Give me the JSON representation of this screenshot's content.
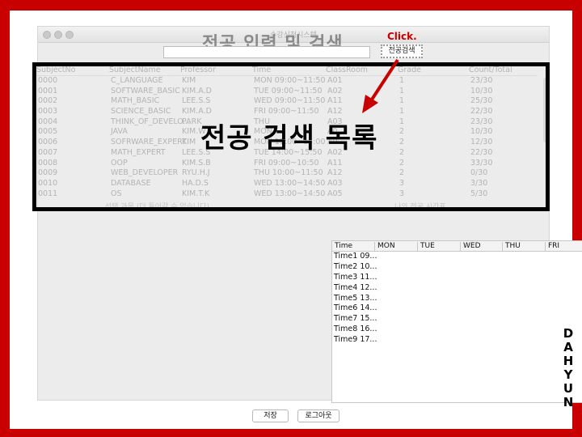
{
  "window": {
    "title": "수강신청시스템"
  },
  "heading": "전공 입력 및 검색",
  "search": {
    "button_label": "전공검색",
    "click_hint": "Click."
  },
  "overlay_title": "전공 검색 목록",
  "subject_table": {
    "columns": [
      "SubjectNo",
      "SubjectName",
      "Professor",
      "Time",
      "ClassRoom",
      "Grade",
      "Count/Total"
    ],
    "rows": [
      [
        "0000",
        "C_LANGUAGE",
        "KIM",
        "MON 09:00~11:50",
        "A01",
        "1",
        "23/30"
      ],
      [
        "0001",
        "SOFTWARE_BASIC",
        "KIM.A.D",
        "TUE 09:00~11:50",
        "A02",
        "1",
        "10/30"
      ],
      [
        "0002",
        "MATH_BASIC",
        "LEE.S.S",
        "WED 09:00~11:50",
        "A11",
        "1",
        "25/30"
      ],
      [
        "0003",
        "SCIENCE_BASIC",
        "KIM.A.D",
        "FRI 09:00~11:50",
        "A12",
        "1",
        "22/30"
      ],
      [
        "0004",
        "THINK_OF_DEVELO...",
        "PARK",
        "THU",
        "A03",
        "1",
        "23/30"
      ],
      [
        "0005",
        "JAVA",
        "KIM.W",
        "MON",
        "A0",
        "2",
        "10/30"
      ],
      [
        "0006",
        "SOFRWARE_EXPERT",
        "KIM",
        "MON 11:00~14:00",
        "A0",
        "2",
        "12/30"
      ],
      [
        "0007",
        "MATH_EXPERT",
        "LEE.S.S",
        "TUE 14:00~15:50",
        "A02",
        "2",
        "22/30"
      ],
      [
        "0008",
        "OOP",
        "KIM.S.B",
        "FRI 09:00~10:50",
        "A11",
        "2",
        "33/30"
      ],
      [
        "0009",
        "WEB_DEVELOPER",
        "RYU.H.J",
        "THU 10:00~11:50",
        "A12",
        "2",
        "0/30"
      ],
      [
        "0010",
        "DATABASE",
        "HA.D.S",
        "WED 13:00~14:50",
        "A03",
        "3",
        "3/30"
      ],
      [
        "0011",
        "OS",
        "KIM.T.K",
        "WED 13:00~14:50",
        "A05",
        "3",
        "5/30"
      ]
    ]
  },
  "selected_subject_label": "선택 과목 (더 들어갈 수 없습니다)",
  "my_schedule_label": "나의 전공 시간표",
  "schedule": {
    "columns": [
      "Time",
      "MON",
      "TUE",
      "WED",
      "THU",
      "FRI"
    ],
    "rows": [
      "Time1 09...",
      "Time2 10...",
      "Time3 11...",
      "Time4 12...",
      "Time5 13...",
      "Time6 14...",
      "Time7 15...",
      "Time8 16...",
      "Time9 17..."
    ]
  },
  "buttons": {
    "save": "저장",
    "logout": "로그아웃"
  },
  "side_watermark": [
    "D",
    "A",
    "H",
    "Y",
    "U",
    "N"
  ],
  "colors": {
    "frame": "#c80000",
    "annotation_arrow": "#c80000",
    "overlay_border": "#000000"
  }
}
